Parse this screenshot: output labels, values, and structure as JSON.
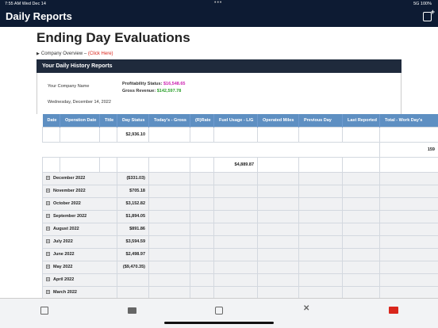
{
  "status_bar": {
    "time": "7:55 AM   Wed Dec 14",
    "right": "5G  100%"
  },
  "nav": {
    "title": "Daily Reports"
  },
  "page": {
    "title": "Ending Day Evaluations",
    "overview_label": "Company Overview –",
    "overview_link": "(Click Here)"
  },
  "panel": {
    "header": "Your Daily History Reports",
    "company": "Your Company Name",
    "date": "Wednesday, December 14, 2022",
    "profit_label": "Profitability Status:",
    "profit_value": "$16,548.65",
    "revenue_label": "Gross Revenue:",
    "revenue_value": "$142,597.78",
    "colors": {
      "profit": "#cc1fb0",
      "revenue": "#2ca02c",
      "header_bg": "#1f2a3c",
      "table_header": "#5e8fc2"
    }
  },
  "table": {
    "headers": [
      "Date",
      "Operation Date",
      "Title",
      "Day Status",
      "Today's - Gross",
      "(R)Rate",
      "Fuel Usage - L/G",
      "Operated Miles",
      "Previous Day",
      "Last Reported",
      "Total - Work Day's"
    ],
    "summary": {
      "day_status": "$2,936.10",
      "work_days": "159",
      "fuel": "$4,889.87"
    },
    "months": [
      {
        "name": "December 2022",
        "value": "($331.03)"
      },
      {
        "name": "November 2022",
        "value": "$705.18"
      },
      {
        "name": "October 2022",
        "value": "$3,152.82"
      },
      {
        "name": "September 2022",
        "value": "$1,894.05"
      },
      {
        "name": "August 2022",
        "value": "$891.86"
      },
      {
        "name": "July 2022",
        "value": "$3,594.59"
      },
      {
        "name": "June 2022",
        "value": "$2,498.97"
      },
      {
        "name": "May 2022",
        "value": "($9,470.35)"
      },
      {
        "name": "April 2022",
        "value": ""
      },
      {
        "name": "March 2022",
        "value": ""
      }
    ]
  },
  "tabbar": {
    "icons": [
      "clipboard-icon",
      "money-icon",
      "wallet-icon",
      "tools-icon",
      "mail-check-icon"
    ]
  }
}
